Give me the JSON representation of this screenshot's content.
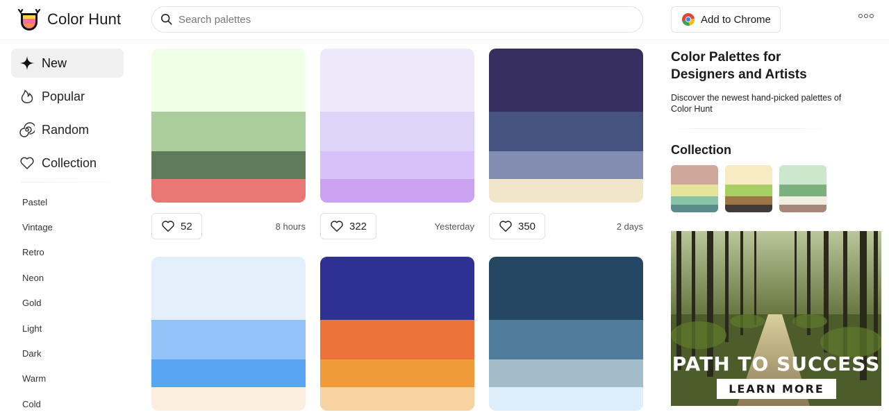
{
  "header": {
    "brand": "Color Hunt",
    "search_placeholder": "Search palettes",
    "chrome_label": "Add to Chrome"
  },
  "sidebar": {
    "nav": [
      {
        "label": "New",
        "icon": "sparkle-icon",
        "active": true
      },
      {
        "label": "Popular",
        "icon": "flame-icon"
      },
      {
        "label": "Random",
        "icon": "spiral-icon"
      },
      {
        "label": "Collection",
        "icon": "heart-icon"
      }
    ],
    "tags": [
      "Pastel",
      "Vintage",
      "Retro",
      "Neon",
      "Gold",
      "Light",
      "Dark",
      "Warm",
      "Cold"
    ]
  },
  "palettes": [
    {
      "colors": [
        "#F0FFE8",
        "#ABCD9B",
        "#5E7C5A",
        "#E97774"
      ],
      "likes": "52",
      "time": "8 hours"
    },
    {
      "colors": [
        "#EDE8FA",
        "#DED3F8",
        "#D6C1F8",
        "#C9A3F0"
      ],
      "likes": "322",
      "time": "Yesterday"
    },
    {
      "colors": [
        "#372F60",
        "#46527F",
        "#838CB1",
        "#F2E6CA"
      ],
      "likes": "350",
      "time": "2 days"
    },
    {
      "colors": [
        "#E3F0FC",
        "#92C2F7",
        "#59A5F4",
        "#FCEEDF"
      ],
      "likes": "",
      "time": ""
    },
    {
      "colors": [
        "#2E3192",
        "#EC733A",
        "#F19A39",
        "#F8D3A2"
      ],
      "likes": "",
      "time": ""
    },
    {
      "colors": [
        "#264763",
        "#507C9C",
        "#A2BCCA",
        "#DEEEFA"
      ],
      "likes": "",
      "time": ""
    }
  ],
  "right_panel": {
    "title": "Color Palettes for Designers and Artists",
    "subtitle": "Discover the newest hand-picked palettes of Color Hunt",
    "collection_title": "Collection",
    "collection": [
      [
        "#CFA79B",
        "#E5E49A",
        "#86C3A7",
        "#5B8B8B"
      ],
      [
        "#F7EBC3",
        "#A8CF63",
        "#9D7443",
        "#423A38"
      ],
      [
        "#CCE7CC",
        "#7BAF7E",
        "#F1EDE0",
        "#A6877A"
      ]
    ]
  },
  "ad": {
    "headline": "PATH TO SUCCESS",
    "cta": "LEARN MORE"
  }
}
